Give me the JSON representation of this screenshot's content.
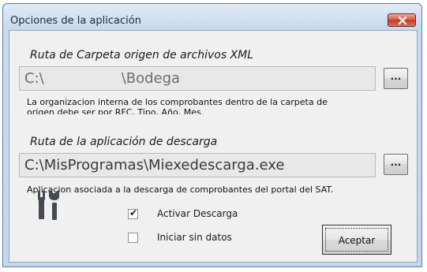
{
  "window": {
    "title": "Opciones de la aplicación",
    "close_icon": "close-icon"
  },
  "source": {
    "label": "Ruta de Carpeta origen de archivos XML",
    "path_start": "C:\\",
    "path_end": "\\Bodega",
    "browse_label": "...",
    "description_line1": "La organizacion interna de los comprobantes dentro de la carpeta de",
    "description_line2": "origen debe ser por RFC, Tipo, Año, Mes."
  },
  "app": {
    "label": "Ruta de la aplicación de descarga",
    "path": "C:\\MisProgramas\\Miexedescarga.exe",
    "browse_label": "...",
    "description": "Aplicacion asociada a la descarga de comprobantes del portal del SAT."
  },
  "options": {
    "activar_label": "Activar Descarga",
    "activar_checked": true,
    "iniciar_label": "Iniciar sin datos",
    "iniciar_checked": false
  },
  "accept_label": "Aceptar",
  "icons": {
    "tools": "tools-icon"
  }
}
